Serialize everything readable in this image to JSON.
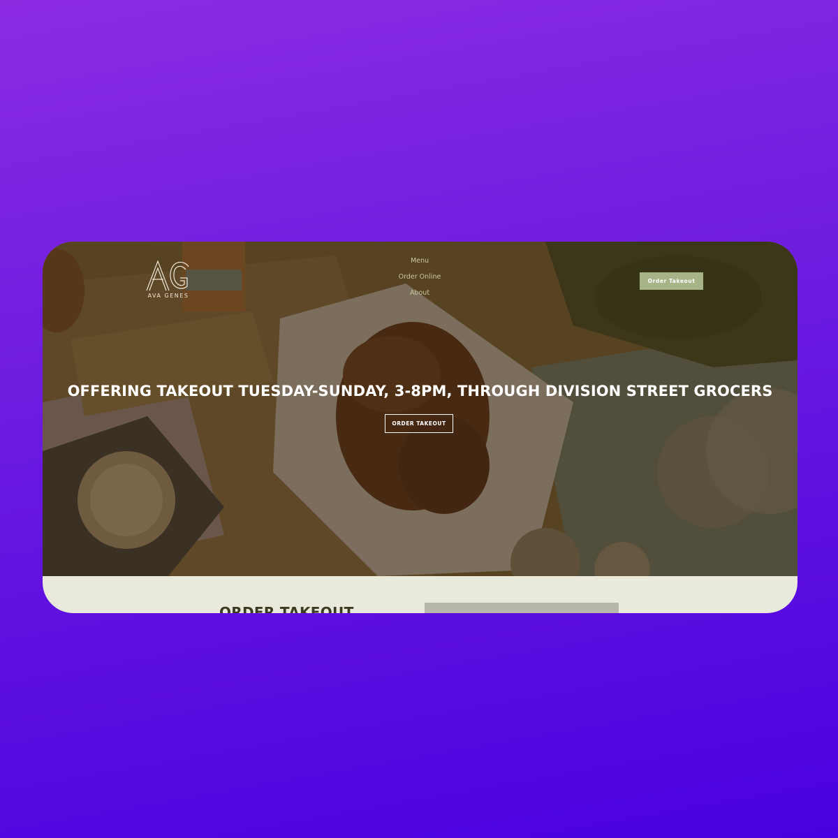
{
  "brand": {
    "logo_text": "AVA GENES"
  },
  "nav": {
    "items": [
      "Menu",
      "Order Online",
      "About"
    ]
  },
  "header": {
    "cta_label": "Order Takeout"
  },
  "hero": {
    "headline": "OFFERING TAKEOUT TUESDAY-SUNDAY, 3-8PM, THROUGH DIVISION STREET GROCERS",
    "cta_label": "ORDER TAKEOUT"
  },
  "section": {
    "title": "ORDER TAKEOUT"
  },
  "colors": {
    "background_top": "#8a2be2",
    "background_bottom": "#4a00e0",
    "accent": "#a7b487",
    "page_bg": "#e9e9dc",
    "heading_dark": "#3b3b22"
  }
}
